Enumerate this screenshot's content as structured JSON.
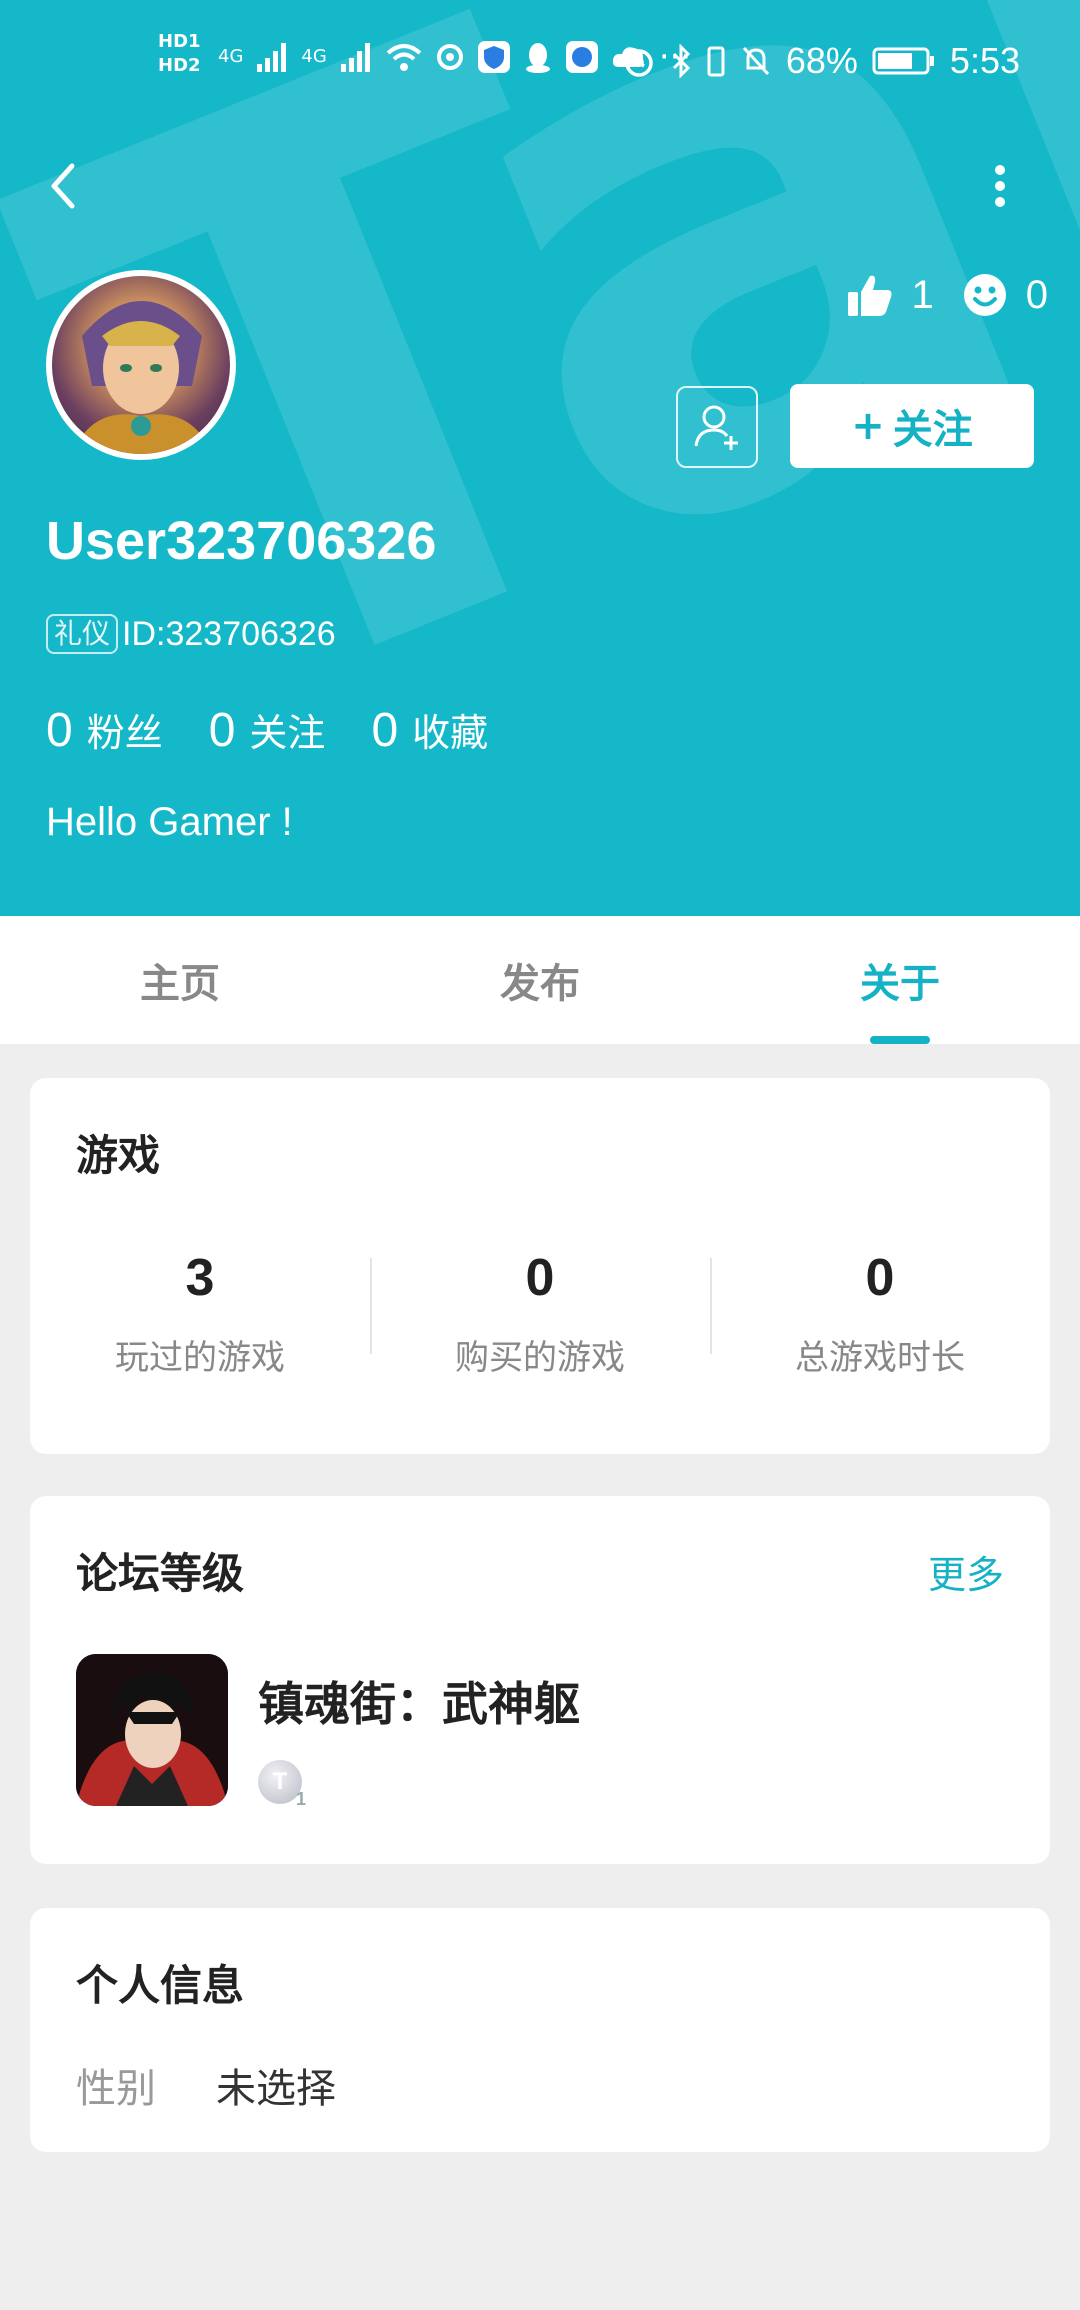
{
  "status_bar": {
    "hd_labels": [
      "HD1",
      "HD2"
    ],
    "signal_labels": [
      "4G",
      "4G"
    ],
    "more_dots": "···",
    "battery_percent": "68%",
    "time": "5:53"
  },
  "header": {
    "watermark_text": "TapTap",
    "username": "User323706326",
    "badge_label": "礼仪",
    "id_text": "ID:323706326",
    "likes_count": "1",
    "smiles_count": "0",
    "follow_button_label": "关注",
    "follow_plus": "+",
    "bio": "Hello Gamer !",
    "stats": [
      {
        "value": "0",
        "label": "粉丝"
      },
      {
        "value": "0",
        "label": "关注"
      },
      {
        "value": "0",
        "label": "收藏"
      }
    ]
  },
  "tabs": [
    {
      "label": "主页",
      "active": false
    },
    {
      "label": "发布",
      "active": false
    },
    {
      "label": "关于",
      "active": true
    }
  ],
  "games_card": {
    "title": "游戏",
    "stats": [
      {
        "value": "3",
        "label": "玩过的游戏"
      },
      {
        "value": "0",
        "label": "购买的游戏"
      },
      {
        "value": "0",
        "label": "总游戏时长"
      }
    ]
  },
  "forum_card": {
    "title": "论坛等级",
    "more_label": "更多",
    "items": [
      {
        "name": "镇魂街：武神躯",
        "level_letter": "T",
        "level_num": "1"
      }
    ]
  },
  "info_card": {
    "title": "个人信息",
    "rows": [
      {
        "key": "性别",
        "value": "未选择"
      }
    ]
  },
  "colors": {
    "accent": "#15b8c9",
    "background": "#eeeeee"
  }
}
